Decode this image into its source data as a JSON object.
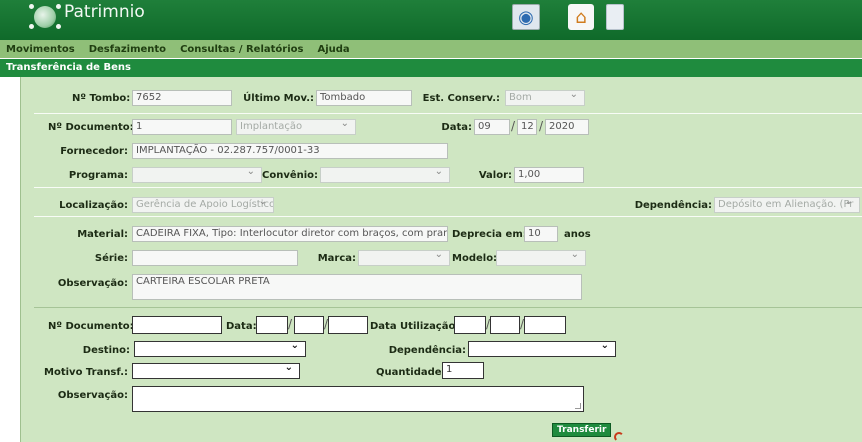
{
  "app": {
    "title": "Patrimnio"
  },
  "menu": [
    "Movimentos",
    "Desfazimento",
    "Consultas / Relatórios",
    "Ajuda"
  ],
  "section_title": "Transferência de Bens",
  "form": {
    "tombo": {
      "label": "Nº Tombo:",
      "value": "7652"
    },
    "ultimo_mov": {
      "label": "Último Mov.:",
      "value": "Tombado"
    },
    "est_conserv": {
      "label": "Est. Conserv.:",
      "value": "Bom"
    },
    "num_documento": {
      "label": "Nº Documento:",
      "value": "1",
      "tipo": "Implantação"
    },
    "data": {
      "label": "Data:",
      "day": "09",
      "month": "12",
      "year": "2020"
    },
    "fornecedor": {
      "label": "Fornecedor:",
      "value": "IMPLANTAÇÃO - 02.287.757/0001-33"
    },
    "programa": {
      "label": "Programa:",
      "value": ""
    },
    "convenio": {
      "label": "Convênio:",
      "value": ""
    },
    "valor": {
      "label": "Valor:",
      "value": "1,00"
    },
    "localizacao": {
      "label": "Localização:",
      "value": "Gerência de Apoio Logístico - G"
    },
    "dependencia": {
      "label": "Dependência:",
      "value": "Depósito em Alienação. (Pr"
    },
    "material": {
      "label": "Material:",
      "value": "CADEIRA FIXA, Tipo: Interlocutor diretor com braços, com pranc"
    },
    "deprecia": {
      "label": "Deprecia em:",
      "value": "10",
      "unit": "anos"
    },
    "serie": {
      "label": "Série:",
      "value": ""
    },
    "marca": {
      "label": "Marca:",
      "value": ""
    },
    "modelo": {
      "label": "Modelo:",
      "value": ""
    },
    "observacao": {
      "label": "Observação:",
      "value": "CARTEIRA ESCOLAR PRETA"
    }
  },
  "transfer": {
    "num_documento_label": "Nº Documento:",
    "data_label": "Data:",
    "data_utilizacao_label": "Data Utilização:",
    "destino_label": "Destino:",
    "dependencia_label": "Dependência:",
    "motivo_label": "Motivo Transf.:",
    "quantidade_label": "Quantidade:",
    "quantidade_value": "1",
    "observacao_label": "Observação:",
    "submit_label": "Transferir"
  }
}
